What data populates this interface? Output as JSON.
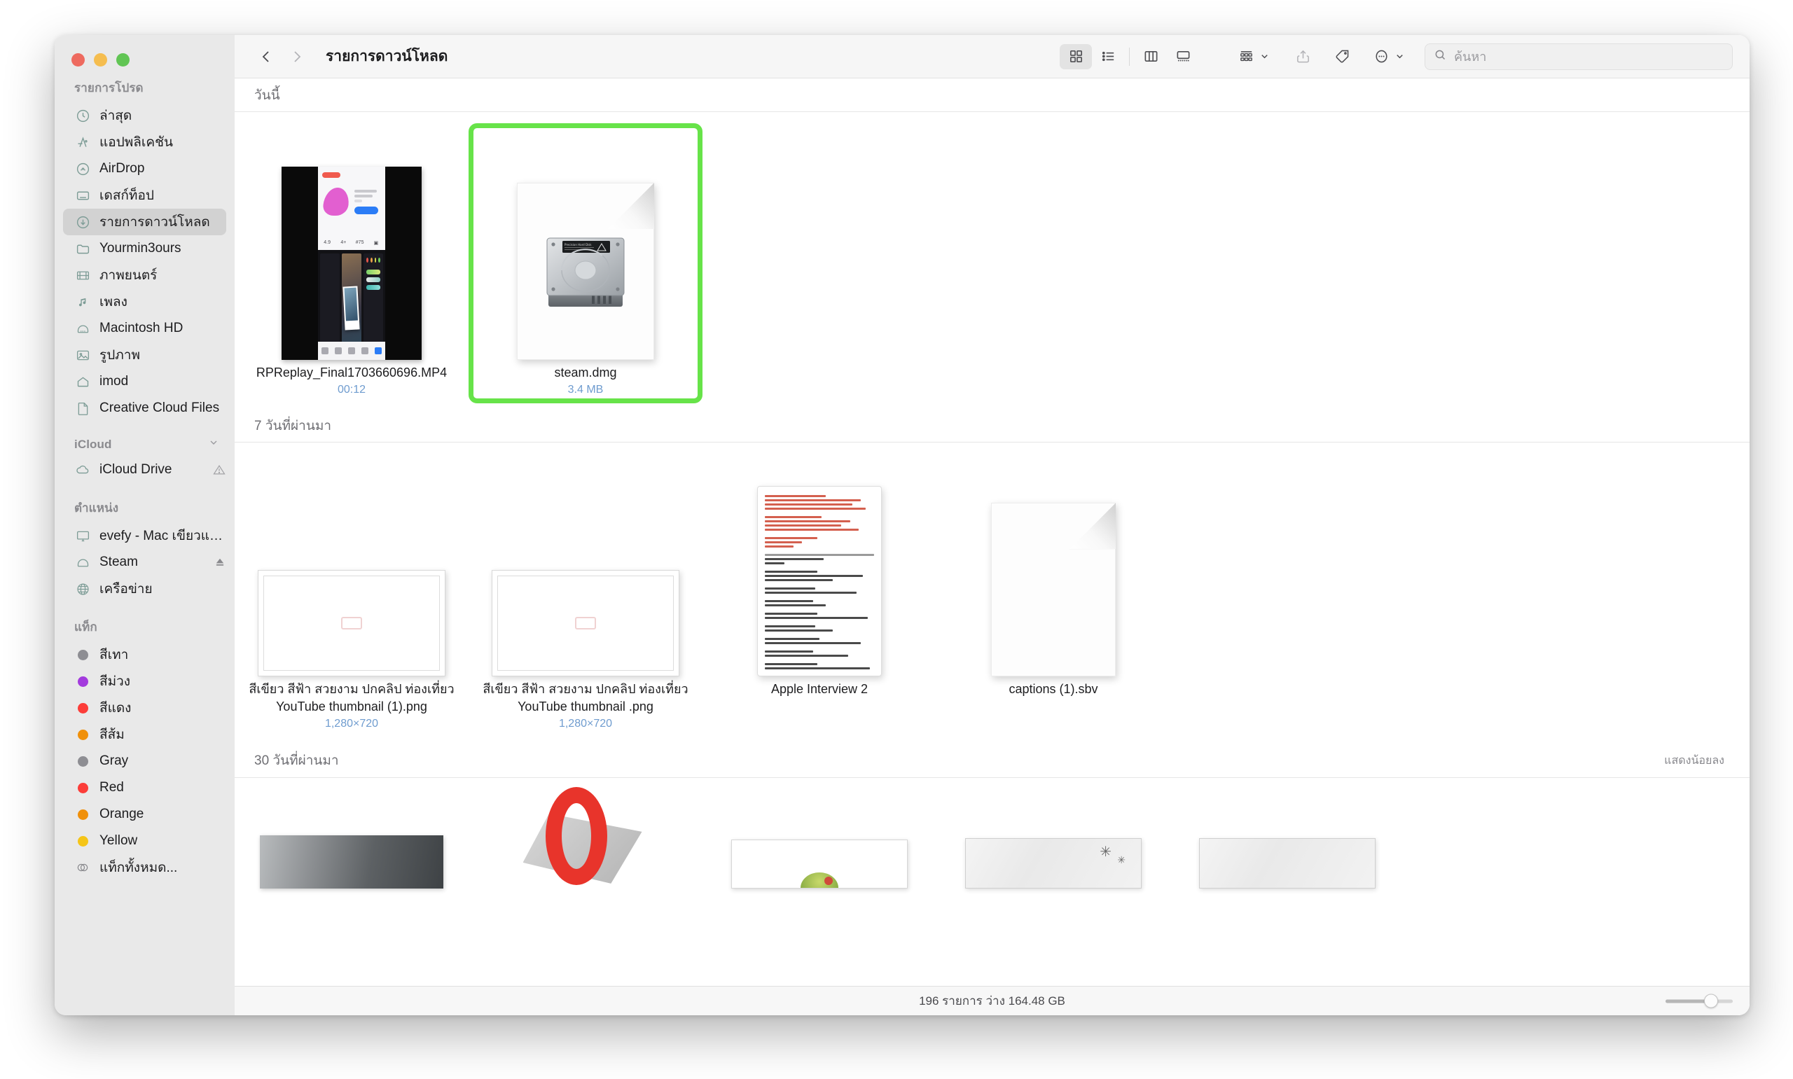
{
  "window": {
    "title": "รายการดาวน์โหลด",
    "traffic_lights": [
      "close",
      "minimize",
      "zoom"
    ]
  },
  "toolbar": {
    "back": "‹",
    "forward": "›",
    "view_icon_grid": "grid-view-icon",
    "view_list": "list-view-icon",
    "view_column": "column-view-icon",
    "view_gallery": "gallery-view-icon",
    "group_by": "group-by-icon",
    "share": "share-icon",
    "tag": "tag-icon",
    "more": "more-actions-icon"
  },
  "search": {
    "placeholder": "ค้นหา"
  },
  "sidebar": {
    "groups": [
      {
        "title": "รายการโปรด",
        "items": [
          {
            "label": "ล่าสุด",
            "icon": "clock-icon",
            "active": false
          },
          {
            "label": "แอปพลิเคชัน",
            "icon": "applications-icon",
            "active": false
          },
          {
            "label": "AirDrop",
            "icon": "airdrop-icon",
            "active": false
          },
          {
            "label": "เดสก์ท็อป",
            "icon": "desktop-icon",
            "active": false
          },
          {
            "label": "รายการดาวน์โหลด",
            "icon": "downloads-icon",
            "active": true
          },
          {
            "label": "Yourmin3ours",
            "icon": "folder-icon",
            "active": false
          },
          {
            "label": "ภาพยนตร์",
            "icon": "movies-icon",
            "active": false
          },
          {
            "label": "เพลง",
            "icon": "music-icon",
            "active": false
          },
          {
            "label": "Macintosh HD",
            "icon": "harddisk-icon",
            "active": false
          },
          {
            "label": "รูปภาพ",
            "icon": "pictures-icon",
            "active": false
          },
          {
            "label": "imod",
            "icon": "home-icon",
            "active": false
          },
          {
            "label": "Creative Cloud Files",
            "icon": "document-icon",
            "active": false
          }
        ]
      },
      {
        "title": "iCloud",
        "collapsible": true,
        "items": [
          {
            "label": "iCloud Drive",
            "icon": "cloud-icon",
            "trailing": "warning-icon"
          }
        ]
      },
      {
        "title": "ตำแหน่ง",
        "items": [
          {
            "label": "evefy - Mac เขียวแหงๆ",
            "icon": "imac-icon"
          },
          {
            "label": "Steam",
            "icon": "harddisk-icon",
            "trailing": "eject-icon"
          },
          {
            "label": "เครือข่าย",
            "icon": "network-icon"
          }
        ]
      },
      {
        "title": "แท็ก",
        "items": [
          {
            "label": "สีเทา",
            "icon": "tag-dot",
            "color": "#8e8e93"
          },
          {
            "label": "สีม่วง",
            "icon": "tag-dot",
            "color": "#a martial"
          },
          {
            "label": "สีแดง",
            "icon": "tag-dot",
            "color": "#fc3d39"
          },
          {
            "label": "สีส้ม",
            "icon": "tag-dot",
            "color": "#f0900a"
          },
          {
            "label": "Gray",
            "icon": "tag-dot",
            "color": "#8e8e93"
          },
          {
            "label": "Red",
            "icon": "tag-dot",
            "color": "#fc3d39"
          },
          {
            "label": "Orange",
            "icon": "tag-dot",
            "color": "#f0900a"
          },
          {
            "label": "Yellow",
            "icon": "tag-dot",
            "color": "#f5c518"
          },
          {
            "label": "แท็กทั้งหมด...",
            "icon": "all-tags-icon"
          }
        ]
      }
    ]
  },
  "sections": [
    {
      "header": "วันนี้",
      "show_less": "",
      "files": [
        {
          "name": "RPReplay_Final1703660696.MP4",
          "meta": "00:12",
          "kind": "video",
          "selected": false
        },
        {
          "name": "steam.dmg",
          "meta": "3.4 MB",
          "kind": "dmg",
          "selected": true
        }
      ]
    },
    {
      "header": "7 วันที่ผ่านมา",
      "show_less": "",
      "files": [
        {
          "name": "สีเขียว สีฟ้า สวยงาม ปกคลิป ท่องเที่ยว YouTube thumbnail  (1).png",
          "meta": "1,280×720",
          "kind": "image",
          "selected": false
        },
        {
          "name": "สีเขียว สีฟ้า สวยงาม ปกคลิป ท่องเที่ยว YouTube thumbnail .png",
          "meta": "1,280×720",
          "kind": "image",
          "selected": false
        },
        {
          "name": "Apple Interview 2",
          "meta": "",
          "kind": "text-doc",
          "selected": false
        },
        {
          "name": "captions (1).sbv",
          "meta": "",
          "kind": "blank-doc",
          "selected": false
        }
      ]
    },
    {
      "header": "30 วันที่ผ่านมา",
      "show_less": "แสดงน้อยลง",
      "files": [
        {
          "name": "",
          "meta": "",
          "kind": "photo",
          "selected": false
        },
        {
          "name": "",
          "meta": "",
          "kind": "opera-logo",
          "selected": false
        },
        {
          "name": "",
          "meta": "",
          "kind": "avocado-doc",
          "selected": false
        },
        {
          "name": "",
          "meta": "",
          "kind": "paper1",
          "selected": false
        },
        {
          "name": "",
          "meta": "",
          "kind": "paper2",
          "selected": false
        }
      ]
    }
  ],
  "status": {
    "text": "196 รายการ ว่าง 164.48 GB",
    "zoom_slider_percent": 68
  },
  "colors": {
    "selection_green": "#67e349",
    "meta_blue": "#6f9ccf",
    "sidebar_bg": "#e9e9e9",
    "toolbar_bg": "#f6f6f6"
  }
}
